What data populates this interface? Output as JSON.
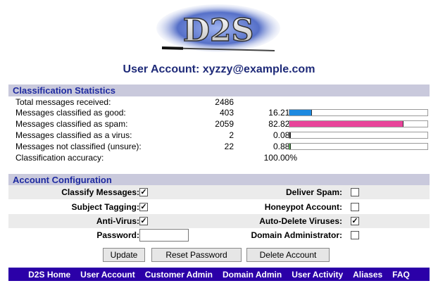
{
  "header": {
    "logo_text": "D2S",
    "account_title": "User Account: xyzzy@example.com"
  },
  "stats": {
    "title": "Classification Statistics",
    "rows": [
      {
        "label": "Total messages received:",
        "count": "2486",
        "pct": ""
      },
      {
        "label": "Messages classified as good:",
        "count": "403",
        "pct": "16.21%",
        "fraction": 0.1621,
        "color": "#1e8ae0"
      },
      {
        "label": "Messages classified as spam:",
        "count": "2059",
        "pct": "82.82%",
        "fraction": 0.8282,
        "color": "#e8449a"
      },
      {
        "label": "Messages classified as a virus:",
        "count": "2",
        "pct": "0.08%",
        "fraction": 0.0008,
        "color": "#111111"
      },
      {
        "label": "Messages not classified (unsure):",
        "count": "22",
        "pct": "0.88%",
        "fraction": 0.0088,
        "color": "#22aa22"
      },
      {
        "label": "Classification accuracy:",
        "count": "",
        "pct": "100.00%"
      }
    ]
  },
  "config": {
    "title": "Account Configuration",
    "rows": [
      {
        "left_label": "Classify Messages:",
        "left_checked": true,
        "right_label": "Deliver Spam:",
        "right_checked": false
      },
      {
        "left_label": "Subject Tagging:",
        "left_checked": true,
        "right_label": "Honeypot Account:",
        "right_checked": false
      },
      {
        "left_label": "Anti-Virus:",
        "left_checked": true,
        "right_label": "Auto-Delete Viruses:",
        "right_checked": true
      },
      {
        "left_label": "Password:",
        "password_value": "",
        "right_label": "Domain Administrator:",
        "right_checked": false
      }
    ]
  },
  "buttons": {
    "update": "Update",
    "reset_password": "Reset Password",
    "delete_account": "Delete Account"
  },
  "nav": [
    "D2S Home",
    "User Account",
    "Customer Admin",
    "Domain Admin",
    "User Activity",
    "Aliases",
    "FAQ"
  ]
}
